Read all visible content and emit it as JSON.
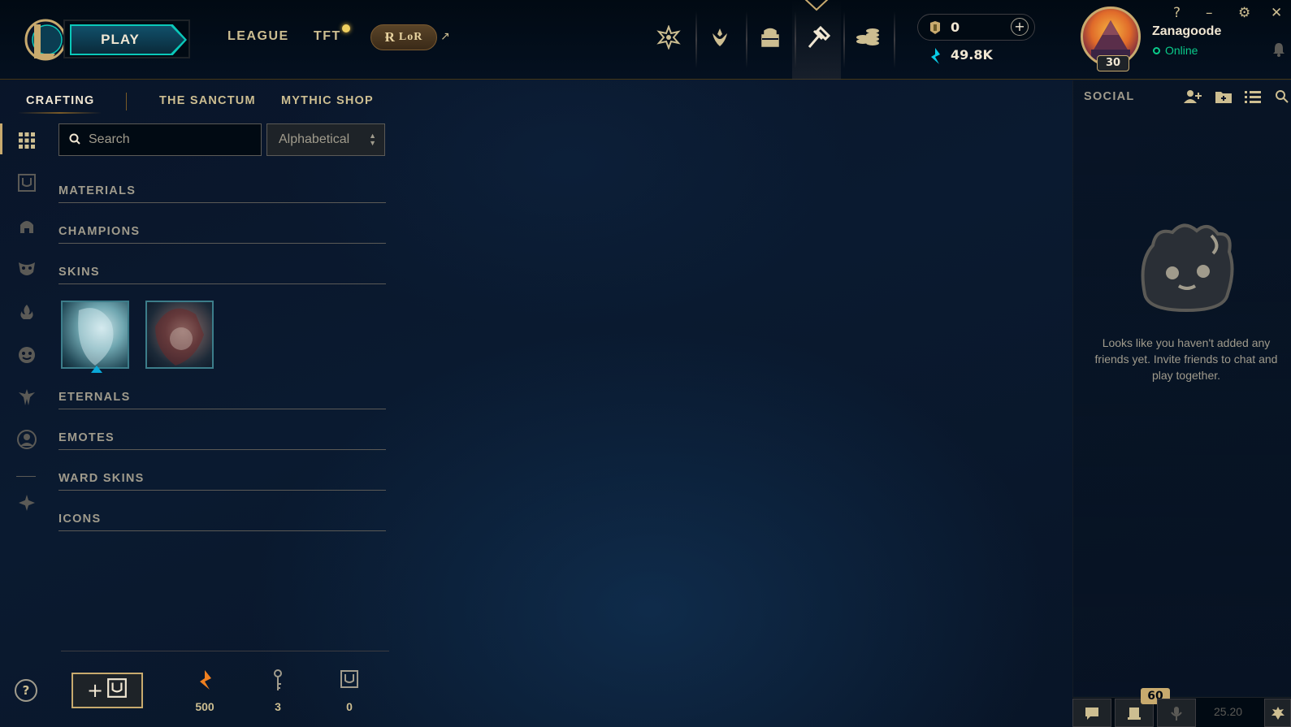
{
  "colors": {
    "gold": "#c8aa6e",
    "gold_light": "#f0e6d2",
    "teal": "#0ac8b9",
    "bg_dark": "#010a13",
    "online_green": "#0acb8a",
    "text_muted": "#a09b8c"
  },
  "topbar": {
    "play_label": "PLAY",
    "nav": [
      "LEAGUE",
      "TFT"
    ],
    "lor_label": "LoR",
    "store_icons": [
      "home-icon",
      "collection-icon",
      "loot-icon",
      "crafting-icon",
      "store-icon"
    ],
    "currency": {
      "rp": "0",
      "blue_essence": "49.8K"
    },
    "profile": {
      "name": "Zanagoode",
      "status": "Online",
      "level": "30"
    },
    "window_controls": [
      "?",
      "–",
      "⚙",
      "✕"
    ]
  },
  "subnav": {
    "items": [
      "CRAFTING",
      "THE SANCTUM",
      "MYTHIC SHOP"
    ],
    "active": "CRAFTING"
  },
  "rail": {
    "icons": [
      "all-items-icon",
      "chest-icon",
      "champion-icon",
      "skin-icon",
      "fire-icon",
      "emote-icon",
      "tft-icon",
      "profile-icon",
      "ward-icon"
    ]
  },
  "search": {
    "placeholder": "Search",
    "value": ""
  },
  "sort": {
    "selected": "Alphabetical"
  },
  "categories": [
    {
      "label": "MATERIALS"
    },
    {
      "label": "CHAMPIONS"
    },
    {
      "label": "SKINS"
    },
    {
      "label": "ETERNALS"
    },
    {
      "label": "EMOTES"
    },
    {
      "label": "WARD SKINS"
    },
    {
      "label": "ICONS"
    }
  ],
  "skins": {
    "count_shown": 2
  },
  "resources": {
    "orange_essence": "500",
    "keys": "3",
    "chests": "0"
  },
  "social": {
    "title": "SOCIAL",
    "empty_message": "Looks like you haven't added any friends yet. Invite friends to chat and play together.",
    "count_badge": "60",
    "version": "25.20"
  }
}
